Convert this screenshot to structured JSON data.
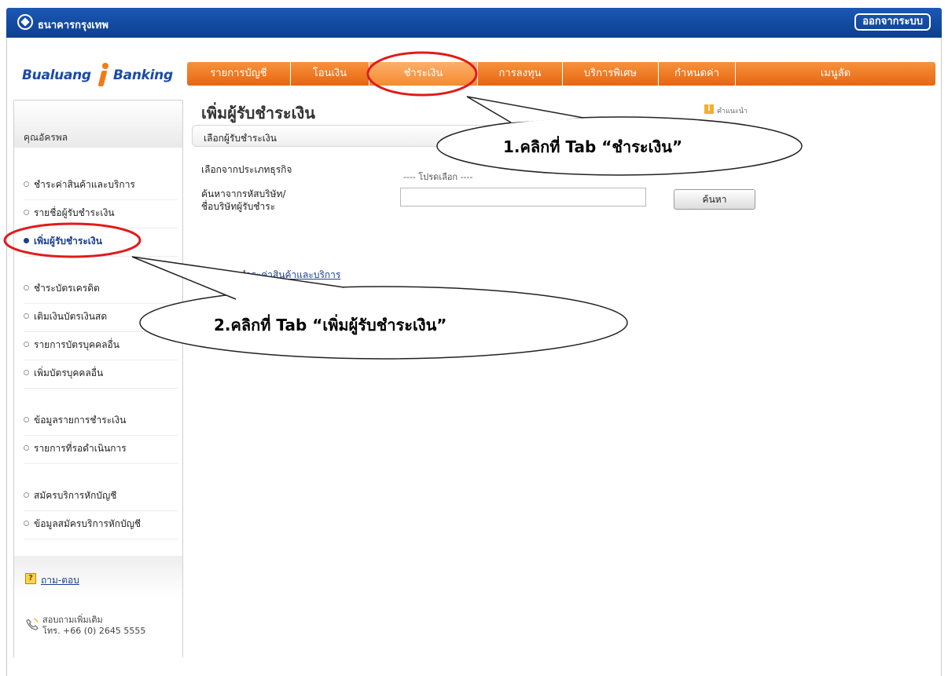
{
  "topbar": {
    "bank_name": "ธนาคารกรุงเทพ",
    "logout_label": "ออกจากระบบ"
  },
  "brand": {
    "part1": "Bualuang",
    "part2": "Banking"
  },
  "tabs": [
    {
      "label": "รายการบัญชี",
      "active": false
    },
    {
      "label": "โอนเงิน",
      "active": false
    },
    {
      "label": "ชำระเงิน",
      "active": true
    },
    {
      "label": "การลงทุน",
      "active": false
    },
    {
      "label": "บริการพิเศษ",
      "active": false
    },
    {
      "label": "กำหนดค่า",
      "active": false
    },
    {
      "label": "เมนูลัด",
      "active": false
    }
  ],
  "sidebar": {
    "user_name": "คุณอัครพล",
    "items": [
      {
        "label": "ชำระค่าสินค้าและบริการ"
      },
      {
        "label": "รายชื่อผู้รับชำระเงิน"
      },
      {
        "label": "เพิ่มผู้รับชำระเงิน",
        "active": true
      },
      {
        "label": "ชำระบัตรเครดิต"
      },
      {
        "label": "เติมเงินบัตรเงินสด"
      },
      {
        "label": "รายการบัตรบุคคลอื่น"
      },
      {
        "label": "เพิ่มบัตรบุคคลอื่น"
      },
      {
        "label": "ข้อมูลรายการชำระเงิน"
      },
      {
        "label": "รายการที่รอดำเนินการ"
      },
      {
        "label": "สมัครบริการหักบัญชี"
      },
      {
        "label": "ข้อมูลสมัครบริการหักบัญชี"
      }
    ],
    "faq_label": "ถาม-ตอบ",
    "contact_label": "สอบถามเพิ่มเติม",
    "contact_phone": "โทร. +66 (0) 2645 5555"
  },
  "main": {
    "title": "เพิ่มผู้รับชำระเงิน",
    "help_label": "คำแนะนำ",
    "section_label": "เลือกผู้รับชำระเงิน",
    "business_type_label": "เลือกจากประเภทธุรกิจ",
    "business_type_value": "---- โปรดเลือก ----",
    "search_label_line1": "ค้นหาจากรหัสบริษัท/",
    "search_label_line2": "ชื่อบริษัทผู้รับชำระ",
    "search_button": "ค้นหา",
    "history_link": "ดูรายการชำระค่าสินค้าและบริการ"
  },
  "annotations": {
    "callout1": "1.คลิกที่ Tab “ชำระเงิน”",
    "callout2": "2.คลิกที่ Tab “เพิ่มผู้รับชำระเงิน”",
    "highlight_color": "#e01b1b"
  }
}
